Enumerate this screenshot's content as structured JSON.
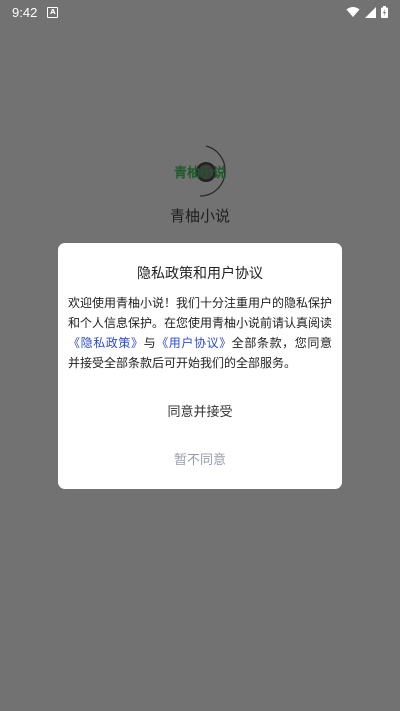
{
  "status_bar": {
    "time": "9:42",
    "notification_icon": "A",
    "icons": [
      "wifi-icon",
      "signal-icon",
      "battery-icon"
    ]
  },
  "splash": {
    "logo_text": "青柚小说",
    "app_name": "青柚小说"
  },
  "dialog": {
    "title": "隐私政策和用户协议",
    "body_part1": "欢迎使用青柚小说！我们十分注重用户的隐私保护和个人信息保护。在您使用青柚小说前请认真阅读",
    "privacy_link": "《隐私政策》",
    "connector": "与",
    "agreement_link": "《用户协议》",
    "body_part2": "全部条款，您同意并接受全部条款后可开始我们的全部服务。",
    "accept_label": "同意并接受",
    "decline_label": "暂不同意"
  },
  "colors": {
    "overlay": "#727272",
    "link": "#2b4bd6",
    "logo_green": "#1f5a2a"
  }
}
